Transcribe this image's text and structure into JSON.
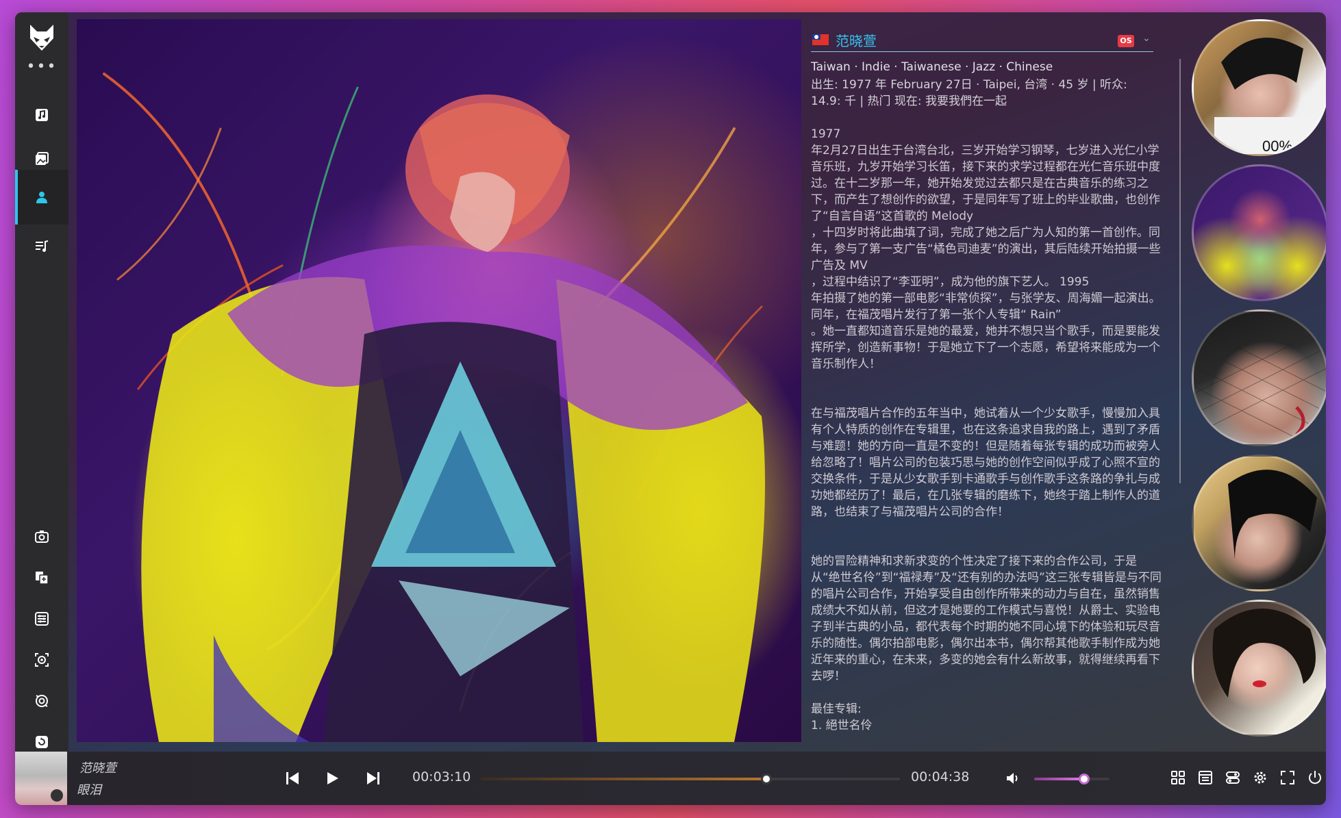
{
  "sidebar": {
    "more_label": "•••",
    "nav": [
      {
        "name": "music-note-icon"
      },
      {
        "name": "gallery-icon"
      },
      {
        "name": "artist-icon"
      },
      {
        "name": "playlist-icon"
      }
    ],
    "tools": [
      {
        "name": "camera-icon"
      },
      {
        "name": "copy-icon"
      },
      {
        "name": "list-settings-icon"
      },
      {
        "name": "gear-frame-icon"
      },
      {
        "name": "refresh-gear-icon"
      },
      {
        "name": "sync-icon"
      }
    ],
    "accent": "#2fc6ea"
  },
  "artist": {
    "name": "范晓萱",
    "badge": "OS",
    "genres": "Taiwan · Indie · Taiwanese · Jazz · Chinese",
    "meta": "出生: 1977 年 February 27日 · Taipei, 台湾 · 45 岁 | 听众: 14.9: 千 | 热门 现在: 我要我們在一起",
    "bio": "1977\n年2月27日出生于台湾台北，三岁开始学习钢琴，七岁进入光仁小学音乐班，九岁开始学习长笛，接下来的求学过程都在光仁音乐班中度过。在十二岁那一年，她开始发觉过去都只是在古典音乐的练习之下，而产生了想创作的欲望，于是同年写了班上的毕业歌曲，也创作了“自言自语”这首歌的 Melody\n，十四岁时将此曲填了词，完成了她之后广为人知的第一首创作。同年，参与了第一支广告“橘色司迪麦”的演出，其后陆续开始拍摄一些广告及 MV\n，过程中结识了“李亚明”，成为他的旗下艺人。 1995\n年拍摄了她的第一部电影“非常侦探”，与张学友、周海媚一起演出。同年，在福茂唱片发行了第一张个人专辑“ Rain”\n。她一直都知道音乐是她的最爱，她并不想只当个歌手，而是要能发挥所学，创造新事物！于是她立下了一个志愿，希望将来能成为一个音乐制作人！\n\n\n在与福茂唱片合作的五年当中，她试着从一个少女歌手，慢慢加入具有个人特质的创作在专辑里，也在这条追求自我的路上，遇到了矛盾与难题！她的方向一直是不变的！但是随着每张专辑的成功而被旁人给忽略了！唱片公司的包装巧思与她的创作空间似乎成了心照不宣的交换条件，于是从少女歌手到卡通歌手与创作歌手这条路的争扎与成功她都经历了！最后，在几张专辑的磨练下，她终于踏上制作人的道路，也结束了与福茂唱片公司的合作！\n\n\n她的冒险精神和求新求变的个性决定了接下来的合作公司，于是从“绝世名伶”到“福禄寿”及“还有别的办法吗”这三张专辑皆是与不同的唱片公司合作，开始享受自由创作所带来的动力与自在，虽然销售成绩大不如从前，但这才是她要的工作模式与喜悦！从爵士、实验电子到半古典的小品，都代表每个时期的她不同心境下的体验和玩尽音乐的随性。偶尔拍部电影，偶尔出本书，偶尔帮其他歌手制作成为她近年来的重心，在未来，多变的她会有什么新故事，就得继续再看下去啰！\n\n最佳专辑:\n1. 絕世名伶"
  },
  "player": {
    "artist": "范晓萱",
    "title": "眼泪",
    "elapsed": "00:03:10",
    "duration": "00:04:38",
    "progress_fraction": 0.682,
    "volume_fraction": 0.66,
    "right_icons": [
      "grid-icon",
      "list-icon",
      "toggle-icon",
      "settings-icon",
      "fullscreen-icon",
      "power-icon"
    ]
  }
}
